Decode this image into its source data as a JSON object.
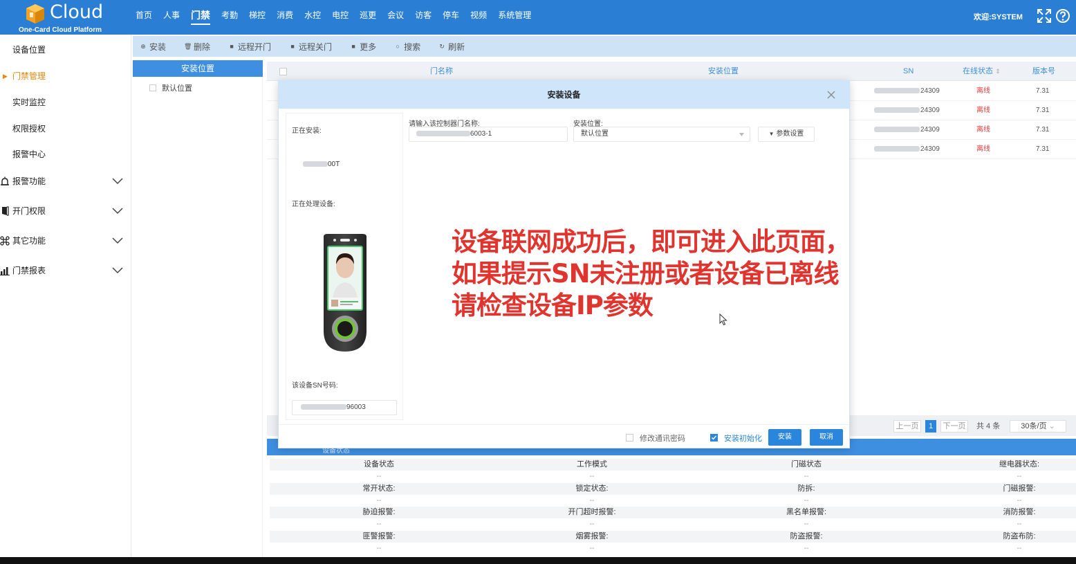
{
  "app": {
    "logo_text": "Cloud",
    "logo_subtitle": "One-Card Cloud Platform",
    "welcome": "欢迎:SYSTEM"
  },
  "topnav": [
    {
      "label": "首页",
      "active": false
    },
    {
      "label": "人事",
      "active": false
    },
    {
      "label": "门禁",
      "active": true
    },
    {
      "label": "考勤",
      "active": false
    },
    {
      "label": "梯控",
      "active": false
    },
    {
      "label": "消费",
      "active": false
    },
    {
      "label": "水控",
      "active": false
    },
    {
      "label": "电控",
      "active": false
    },
    {
      "label": "巡更",
      "active": false
    },
    {
      "label": "会议",
      "active": false
    },
    {
      "label": "访客",
      "active": false
    },
    {
      "label": "停车",
      "active": false
    },
    {
      "label": "视频",
      "active": false
    },
    {
      "label": "系统管理",
      "active": false
    }
  ],
  "sidebar": {
    "items": [
      {
        "label": "设备位置"
      },
      {
        "label": "门禁管理",
        "active": true
      },
      {
        "label": "实时监控"
      },
      {
        "label": "权限授权"
      },
      {
        "label": "报警中心"
      }
    ],
    "groups": [
      {
        "label": "报警功能",
        "icon": "alarm-icon"
      },
      {
        "label": "开门权限",
        "icon": "door-icon"
      },
      {
        "label": "其它功能",
        "icon": "command-icon"
      },
      {
        "label": "门禁报表",
        "icon": "bar-chart-icon"
      }
    ]
  },
  "toolbar": {
    "install": "安装",
    "delete": "删除",
    "remote_open": "远程开门",
    "remote_close": "远程关门",
    "more": "更多",
    "search": "搜索",
    "refresh": "刷新"
  },
  "location_panel": {
    "header": "安装位置",
    "item": "默认位置"
  },
  "table": {
    "headers": {
      "door_name": "门名称",
      "location": "安装位置",
      "sn": "SN",
      "online": "在线状态",
      "version": "版本号"
    },
    "rows": [
      {
        "sn_suffix": "24309",
        "status": "离线",
        "version": "7.31"
      },
      {
        "sn_suffix": "24309",
        "status": "离线",
        "version": "7.31"
      },
      {
        "sn_suffix": "24309",
        "status": "离线",
        "version": "7.31"
      },
      {
        "sn_suffix": "24309",
        "status": "离线",
        "version": "7.31"
      }
    ]
  },
  "pagination": {
    "prev": "上一页",
    "current": "1",
    "next": "下一页",
    "total": "共 4 条",
    "page_size": "30条/页"
  },
  "status_section": {
    "title": "设备状态",
    "rows": [
      [
        "设备状态",
        "工作模式",
        "门磁状态",
        "继电器状态:"
      ],
      [
        "常开状态:",
        "锁定状态:",
        "防拆:",
        "门磁报警:"
      ],
      [
        "胁迫报警:",
        "开门超时报警:",
        "黑名单报警:",
        "消防报警:"
      ],
      [
        "匪警报警:",
        "烟雾报警:",
        "防盗报警:",
        "防盗布防:"
      ]
    ],
    "value": "--"
  },
  "modal": {
    "title": "安装设备",
    "installing_label": "正在安装:",
    "installing_value_suffix": "00T",
    "processing_label": "正在处理设备:",
    "sn_label": "该设备SN号码:",
    "sn_value_suffix": "96003",
    "door_name_label": "请输入该控制器门名称:",
    "door_name_value_suffix": "6003-1",
    "location_label": "安装位置:",
    "location_value": "默认位置",
    "param_button": "参数设置",
    "overlay_lines": [
      "设备联网成功后，即可进入此页面，",
      "如果提示SN未注册或者设备已离线",
      "请检查设备IP参数"
    ],
    "modify_password": "修改通讯密码",
    "install_init": "安装初始化",
    "install_button": "安装",
    "cancel_button": "取消"
  },
  "colors": {
    "primary": "#2a7fd4",
    "accent": "#e8880e",
    "overlay": "#e0342f",
    "offline": "#e03a3a"
  }
}
